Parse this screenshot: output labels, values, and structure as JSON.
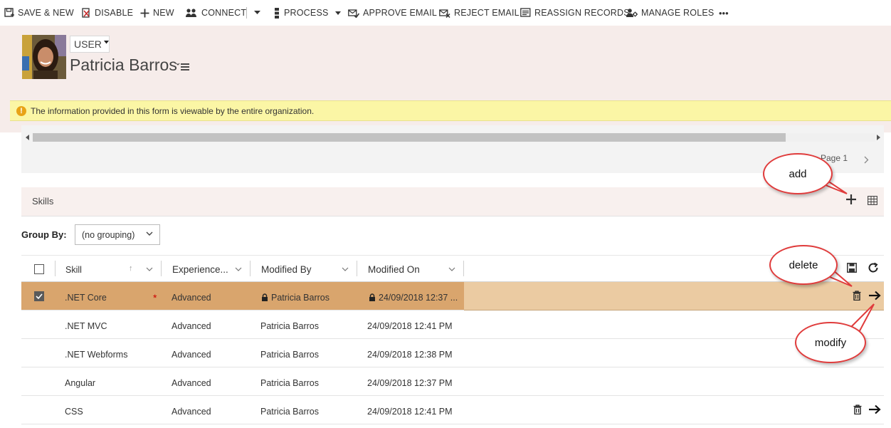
{
  "toolbar": {
    "save_new": "SAVE & NEW",
    "disable": "DISABLE",
    "new": "NEW",
    "connect": "CONNECT",
    "process": "PROCESS",
    "approve_email": "APPROVE EMAIL",
    "reject_email": "REJECT EMAIL",
    "reassign_records": "REASSIGN RECORDS",
    "manage_roles": "MANAGE ROLES",
    "more": "•••"
  },
  "header": {
    "entity": "USER",
    "record_name": "Patricia Barros"
  },
  "notice": {
    "text": "The information provided in this form is viewable by the entire organization."
  },
  "pager": {
    "label": "Page 1"
  },
  "skills": {
    "title": "Skills",
    "group_by_label": "Group By:",
    "group_by_value": "(no grouping)",
    "columns": [
      "Skill",
      "Experience...",
      "Modified By",
      "Modified On"
    ],
    "rows": [
      {
        "skill": ".NET Core",
        "experience": "Advanced",
        "modified_by": "Patricia Barros",
        "modified_on": "24/09/2018 12:37 ...",
        "selected": true
      },
      {
        "skill": ".NET MVC",
        "experience": "Advanced",
        "modified_by": "Patricia Barros",
        "modified_on": "24/09/2018 12:41 PM",
        "selected": false
      },
      {
        "skill": ".NET Webforms",
        "experience": "Advanced",
        "modified_by": "Patricia Barros",
        "modified_on": "24/09/2018 12:38 PM",
        "selected": false
      },
      {
        "skill": "Angular",
        "experience": "Advanced",
        "modified_by": "Patricia Barros",
        "modified_on": "24/09/2018 12:37 PM",
        "selected": false
      },
      {
        "skill": "CSS",
        "experience": "Advanced",
        "modified_by": "Patricia Barros",
        "modified_on": "24/09/2018 12:41 PM",
        "selected": false
      }
    ],
    "required_marker": "*"
  },
  "annotations": {
    "add": "add",
    "delete": "delete",
    "modify": "modify"
  },
  "colors": {
    "header_bg": "#f6ecea",
    "notice_bg": "#fbf6a5",
    "selected_row": "#d9a56d",
    "selected_row_rest": "#ebcba2",
    "callout_border": "#e03c3c"
  }
}
